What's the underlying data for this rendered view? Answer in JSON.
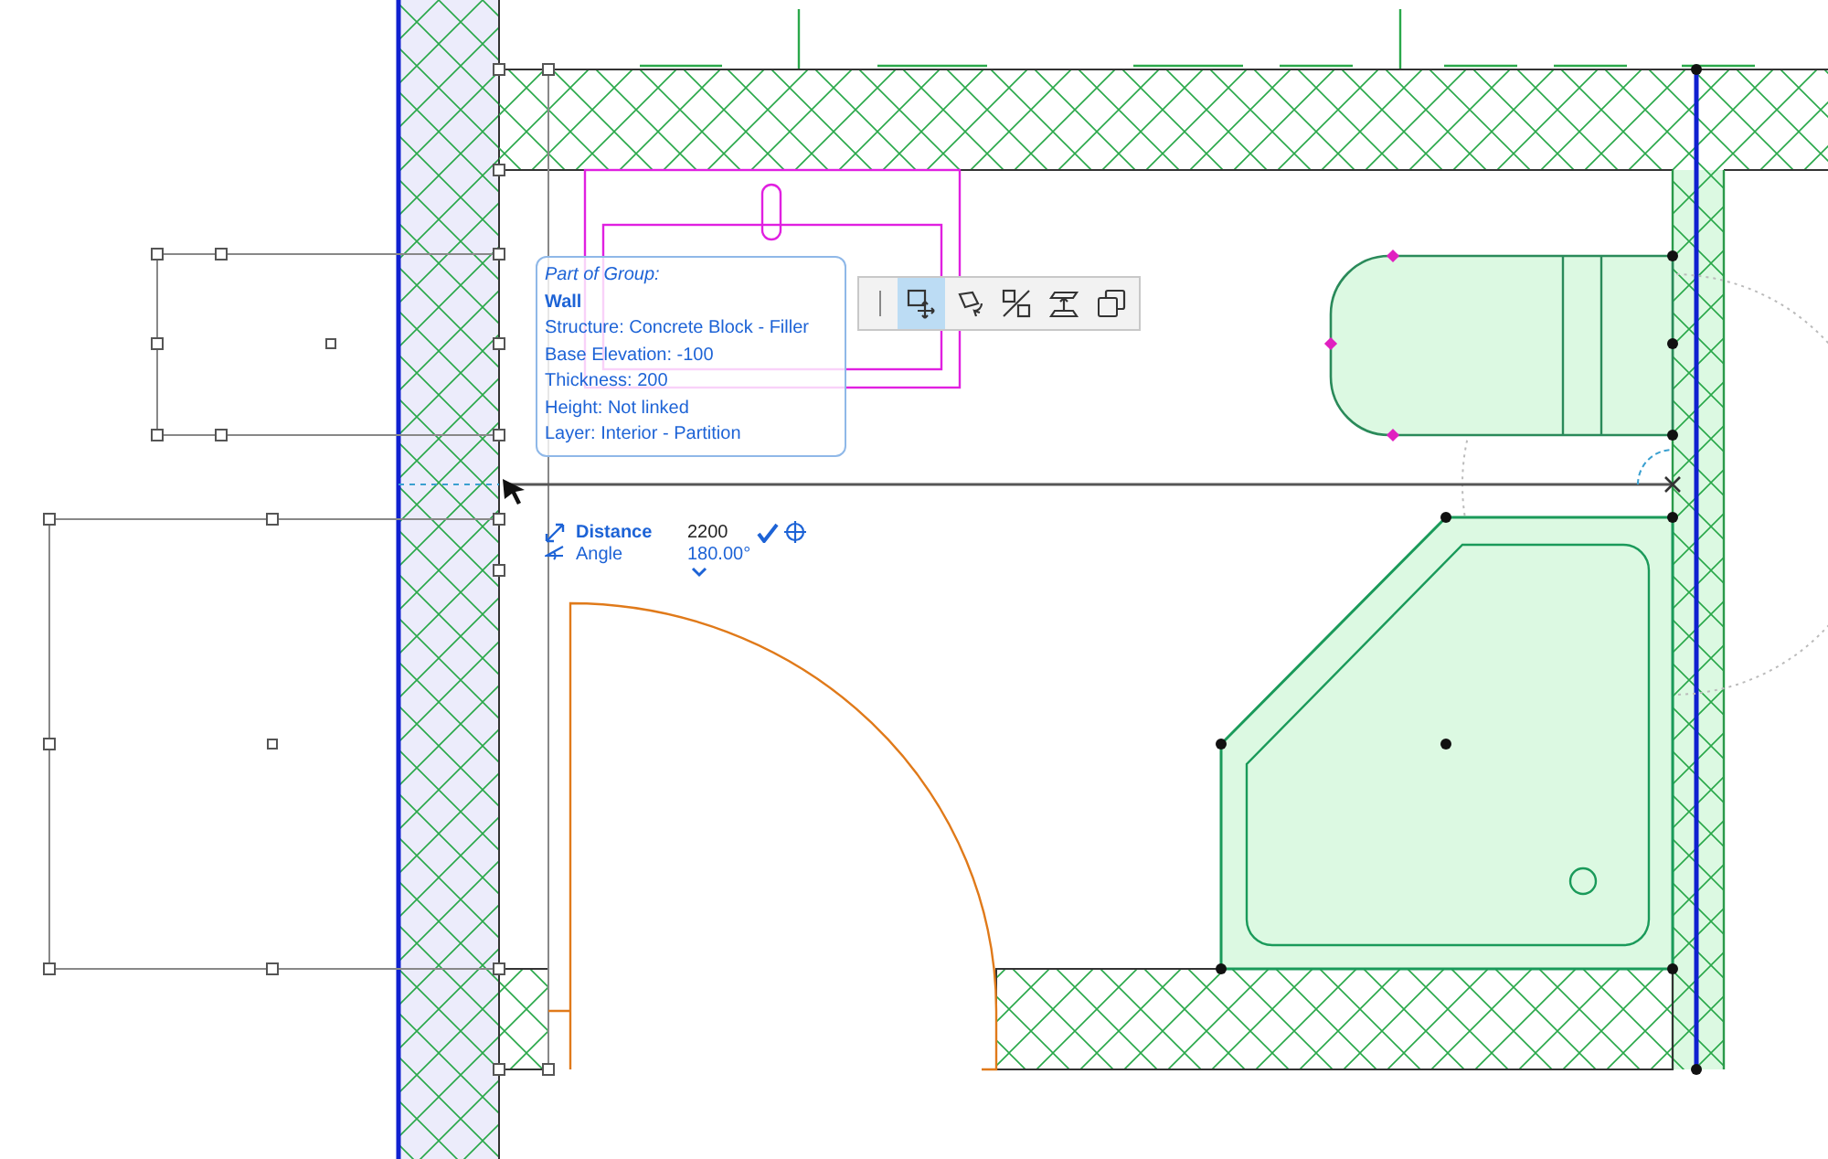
{
  "tooltip": {
    "header": "Part of Group:",
    "title": "Wall",
    "lines": [
      "Structure: Concrete Block - Filler",
      "Base Elevation: -100",
      "Thickness: 200",
      "Height: Not linked",
      "Layer: Interior - Partition"
    ]
  },
  "pet_palette": {
    "tools": [
      {
        "kind": "move",
        "selected": true
      },
      {
        "kind": "rotate",
        "selected": false
      },
      {
        "kind": "mirror",
        "selected": false
      },
      {
        "kind": "elevate",
        "selected": false
      },
      {
        "kind": "copy",
        "selected": false
      }
    ]
  },
  "tracker": {
    "rows": [
      {
        "kind": "distance",
        "label": "Distance",
        "value": "2200"
      },
      {
        "kind": "angle",
        "label": "Angle",
        "value": "180.00°"
      }
    ]
  }
}
